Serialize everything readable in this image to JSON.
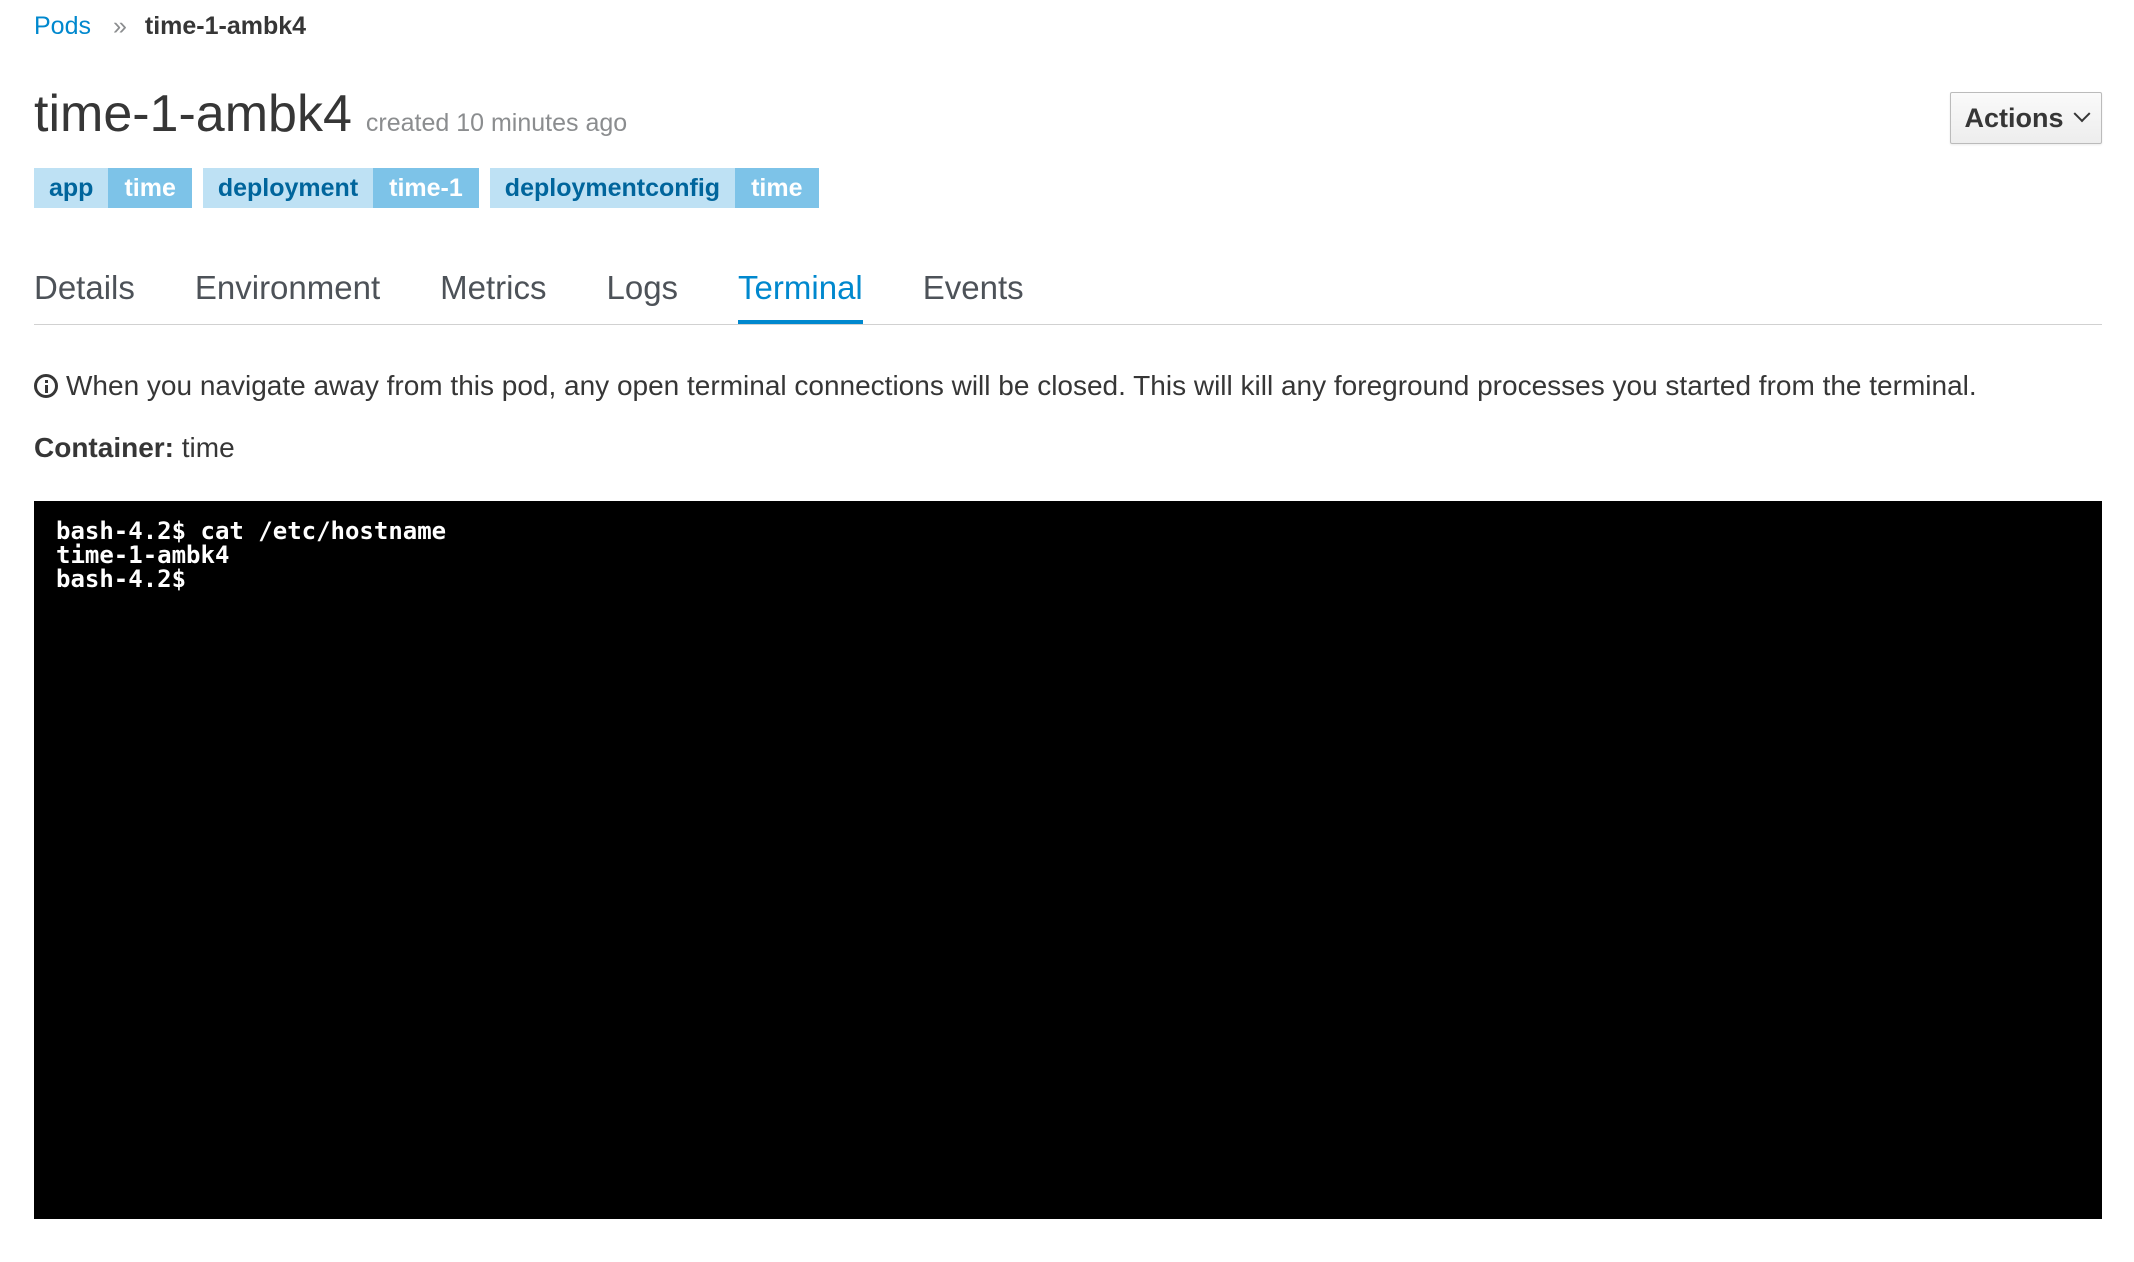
{
  "breadcrumb": {
    "parent": "Pods",
    "separator": "»",
    "current": "time-1-ambk4"
  },
  "header": {
    "title": "time-1-ambk4",
    "created": "created 10 minutes ago",
    "actions_label": "Actions"
  },
  "labels": [
    {
      "key": "app",
      "value": "time"
    },
    {
      "key": "deployment",
      "value": "time-1"
    },
    {
      "key": "deploymentconfig",
      "value": "time"
    }
  ],
  "tabs": [
    {
      "label": "Details"
    },
    {
      "label": "Environment"
    },
    {
      "label": "Metrics"
    },
    {
      "label": "Logs"
    },
    {
      "label": "Terminal",
      "active": true
    },
    {
      "label": "Events"
    }
  ],
  "notice": {
    "icon": "info-icon",
    "text": "When you navigate away from this pod, any open terminal connections will be closed. This will kill any foreground processes you started from the terminal."
  },
  "container": {
    "label": "Container:",
    "value": "time"
  },
  "terminal": {
    "lines": [
      "bash-4.2$ cat /etc/hostname",
      "time-1-ambk4",
      "bash-4.2$"
    ]
  },
  "colors": {
    "link": "#0088ce",
    "label_key_bg": "#bee1f4",
    "label_value_bg": "#7dc3e8",
    "terminal_bg": "#000000"
  }
}
